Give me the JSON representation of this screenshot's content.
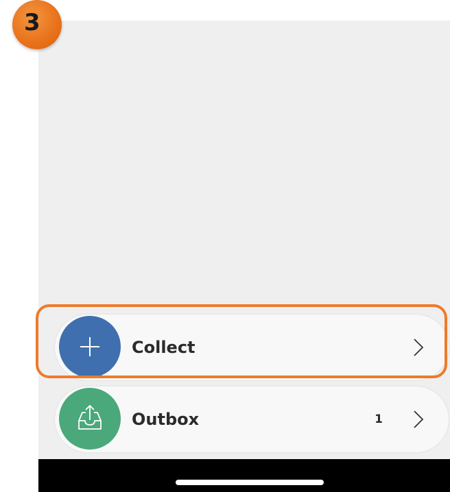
{
  "step": {
    "number": "3",
    "color": "#ee7a2c"
  },
  "list": {
    "collect": {
      "label": "Collect",
      "icon": "plus-icon",
      "icon_bg": "#3f6fae"
    },
    "outbox": {
      "label": "Outbox",
      "count": "1",
      "icon": "inbox-upload-icon",
      "icon_bg": "#4aa87b"
    }
  }
}
